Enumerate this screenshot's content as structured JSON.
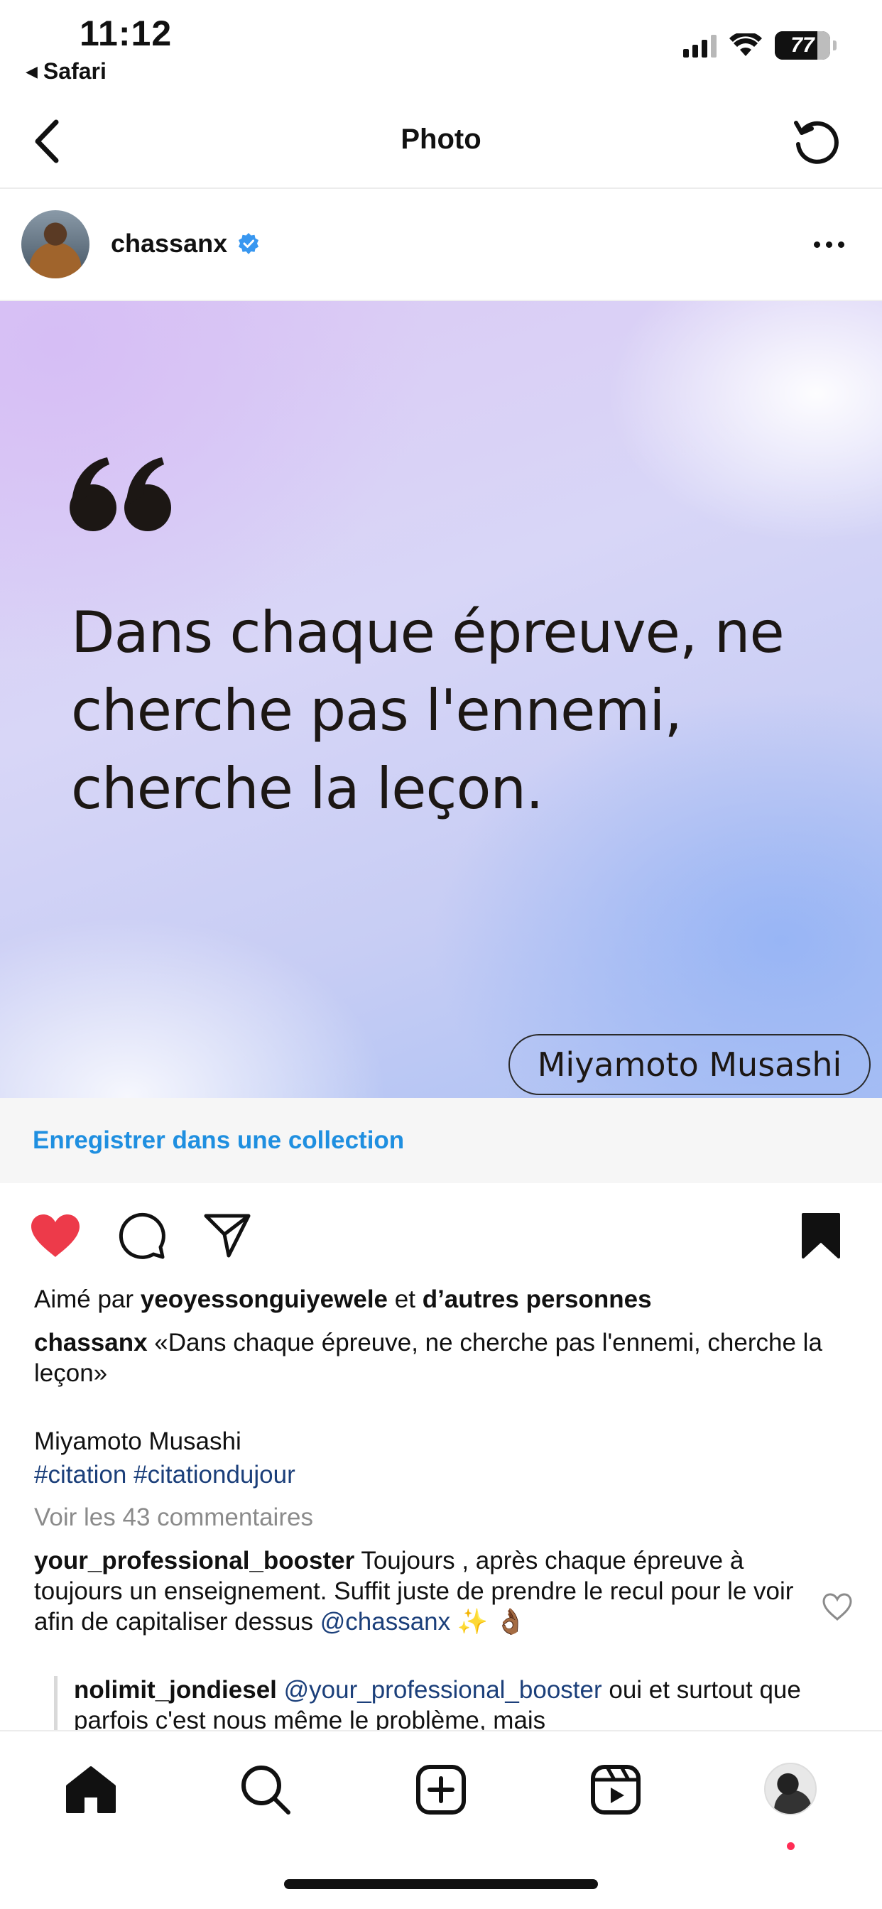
{
  "status_bar": {
    "time": "11:12",
    "back_app": "Safari",
    "battery": "77"
  },
  "nav": {
    "title": "Photo"
  },
  "post": {
    "username": "chassanx",
    "quote": "Dans chaque épreuve, ne cherche pas l'ennemi, cherche la leçon.",
    "author": "Miyamoto Musashi",
    "save_collection": "Enregistrer dans une collection",
    "liked_prefix": "Aimé par",
    "liked_user": "yeoyessonguiyewele",
    "liked_and": "et",
    "liked_others": "d’autres personnes",
    "caption_user": "chassanx",
    "caption_text": "«Dans chaque épreuve, ne cherche pas l'ennemi, cherche la leçon»",
    "caption_author": "Miyamoto Musashi",
    "hashtag_1": "#citation",
    "hashtag_2": "#citationdujour",
    "view_comments": "Voir les 43 commentaires"
  },
  "comments": [
    {
      "user": "your_professional_booster",
      "text": "Toujours , après chaque épreuve à toujours un enseignement. Suffit juste de prendre le recul pour le voir afin de capitaliser dessus",
      "mention": "@chassanx",
      "emoji": "✨ 👌🏾"
    },
    {
      "user": "nolimit_jondiesel",
      "mention": "@your_professional_booster",
      "text": "oui et surtout que parfois c'est nous même le problème, mais"
    }
  ],
  "icons": {
    "like": "heart-filled-icon",
    "comment": "comment-icon",
    "share": "send-icon",
    "save": "bookmark-filled-icon",
    "home": "home-icon",
    "search": "search-icon",
    "create": "plus-square-icon",
    "reels": "reels-icon"
  },
  "colors": {
    "like_red": "#ed3a4a",
    "link_blue": "#1f8fe0",
    "hashtag_blue": "#1b3f7a",
    "verified_blue": "#3897f0"
  }
}
